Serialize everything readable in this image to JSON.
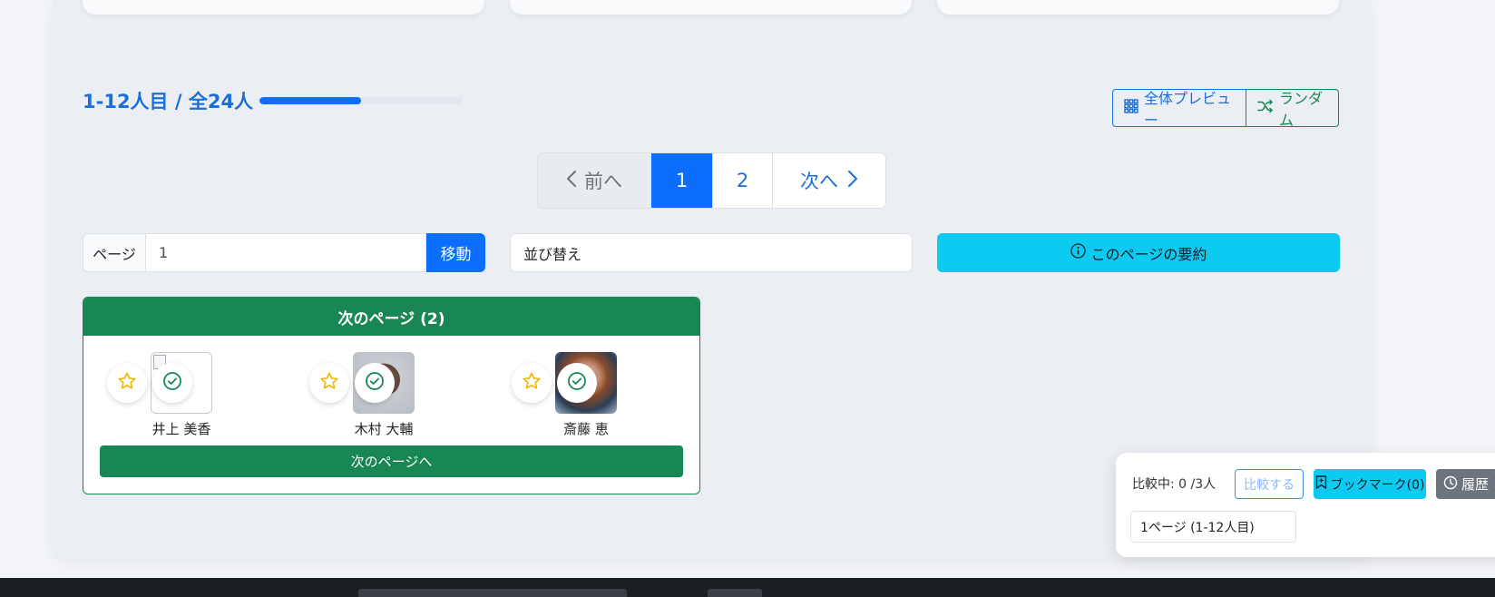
{
  "pagination_info": {
    "range_text": "1-12人目 / 全24人",
    "progress_percent": 50
  },
  "view_buttons": {
    "preview_label": "全体プレビュー",
    "random_label": "ランダム"
  },
  "pager": {
    "prev_label": "前へ",
    "pages": [
      "1",
      "2"
    ],
    "active_page": "1",
    "next_label": "次へ"
  },
  "page_jump": {
    "label": "ページ",
    "value": "1",
    "button_label": "移動"
  },
  "sort": {
    "value": "並び替え"
  },
  "summary_button": {
    "label": "このページの要約"
  },
  "next_page_card": {
    "title": "次のページ (2)",
    "people": [
      {
        "name": "井上 美香"
      },
      {
        "name": "木村 大輔"
      },
      {
        "name": "斎藤 恵"
      }
    ],
    "button_label": "次のページへ"
  },
  "compare_panel": {
    "status_text": "比較中: 0 /3人",
    "compare_button": "比較する",
    "bookmark_button": "ブックマーク(0)",
    "history_button": "履歴",
    "page_select_value": "1ページ (1-12人目)"
  },
  "colors": {
    "primary": "#0d6efd",
    "success": "#198754",
    "info": "#0dcaf0",
    "secondary": "#6c757d",
    "star": "#f2b705"
  }
}
